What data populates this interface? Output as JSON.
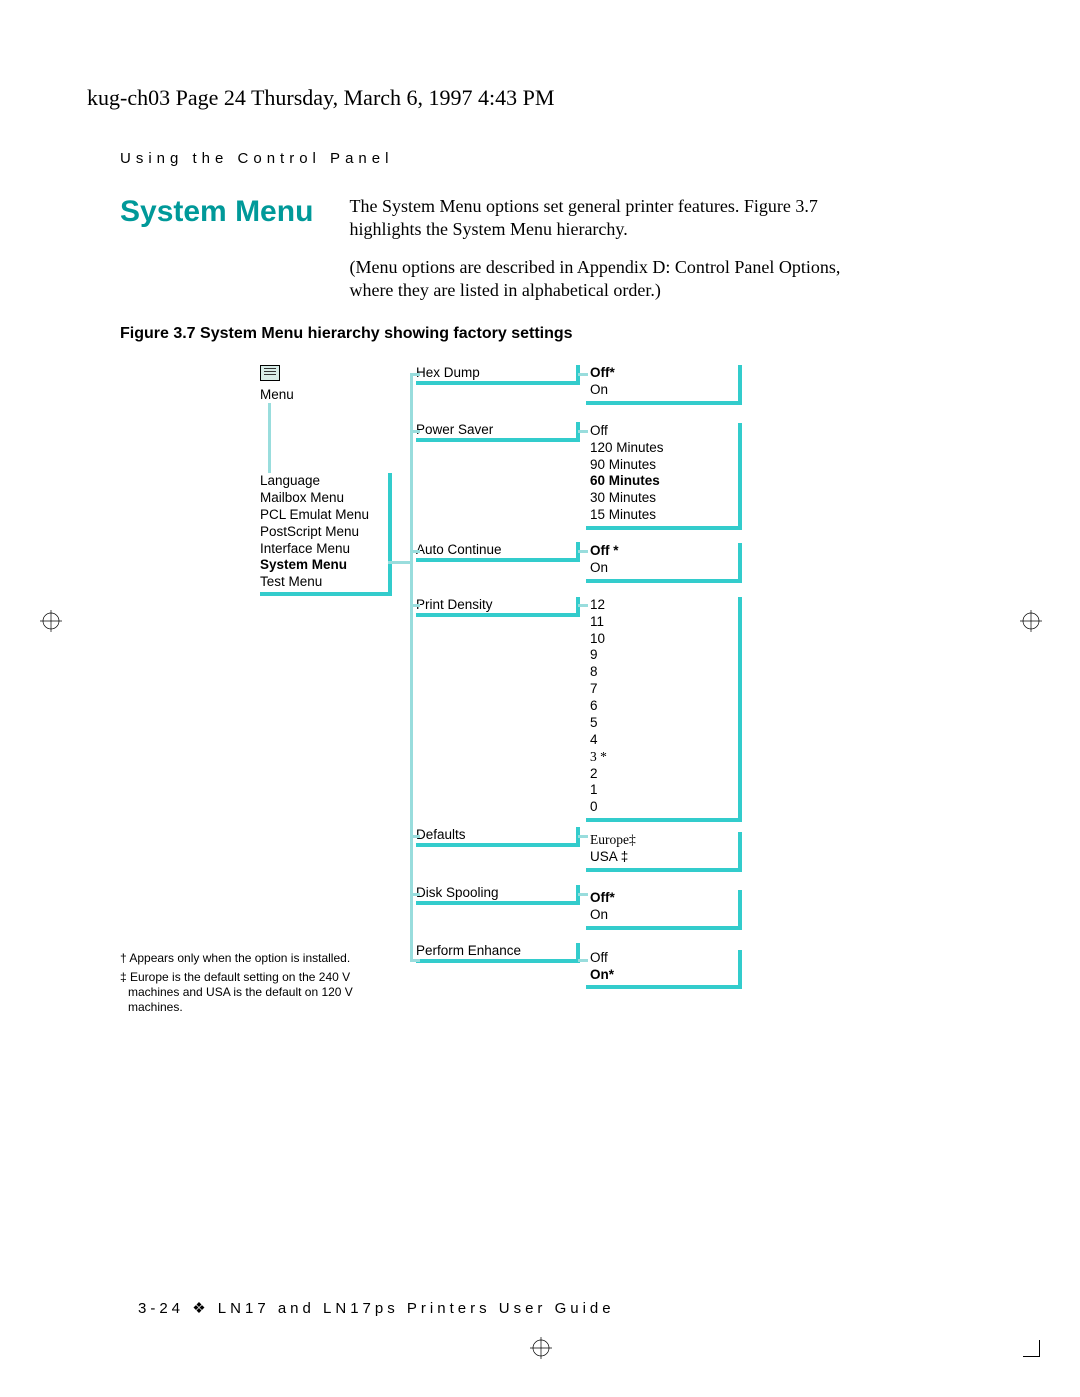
{
  "header": "kug-ch03  Page 24  Thursday, March 6, 1997  4:43 PM",
  "section_label": "Using the Control Panel",
  "title": "System Menu",
  "para1": "The System Menu options set general printer features. Figure 3.7 highlights the System Menu hierarchy.",
  "para2": "(Menu options are described in Appendix D: Control Panel Options, where they are listed in alphabetical order.)",
  "figure_caption": "Figure 3.7    System Menu hierarchy showing factory settings",
  "menu_label": "Menu",
  "toplist": {
    "0": "Language",
    "1": "Mailbox Menu",
    "2": "PCL Emulat Menu",
    "3": "PostScript Menu",
    "4": "Interface Menu",
    "5": "System Menu",
    "6": "Test Menu"
  },
  "col2": {
    "hexdump": "Hex Dump",
    "powersaver": "Power Saver",
    "autocontinue": "Auto Continue",
    "printdensity": "Print Density",
    "defaults": "Defaults",
    "diskspool": "Disk Spooling",
    "perform": "Perform Enhance"
  },
  "vals": {
    "hexdump": {
      "0": "Off*",
      "1": "On"
    },
    "powersaver": {
      "0": "Off",
      "1": "120 Minutes",
      "2": "90 Minutes",
      "3": "60 Minutes",
      "4": "30 Minutes",
      "5": "15 Minutes"
    },
    "autocontinue": {
      "0": "Off *",
      "1": "On"
    },
    "printdensity": {
      "0": "12",
      "1": "11",
      "2": "10",
      "3": "9",
      "4": "8",
      "5": "7",
      "6": "6",
      "7": "5",
      "8": "4",
      "9": "3 *",
      "10": "2",
      "11": "1",
      "12": "0"
    },
    "defaults": {
      "0": "Europe‡",
      "1": "USA ‡"
    },
    "diskspool": {
      "0": "Off*",
      "1": "On"
    },
    "perform": {
      "0": "Off",
      "1": "On*"
    }
  },
  "footnote1": "† Appears only when the option is installed.",
  "footnote2": "‡ Europe is the default setting on the 240 V machines and USA is the default on 120 V machines.",
  "footer": "3-24   ❖   LN17 and LN17ps Printers User Guide"
}
